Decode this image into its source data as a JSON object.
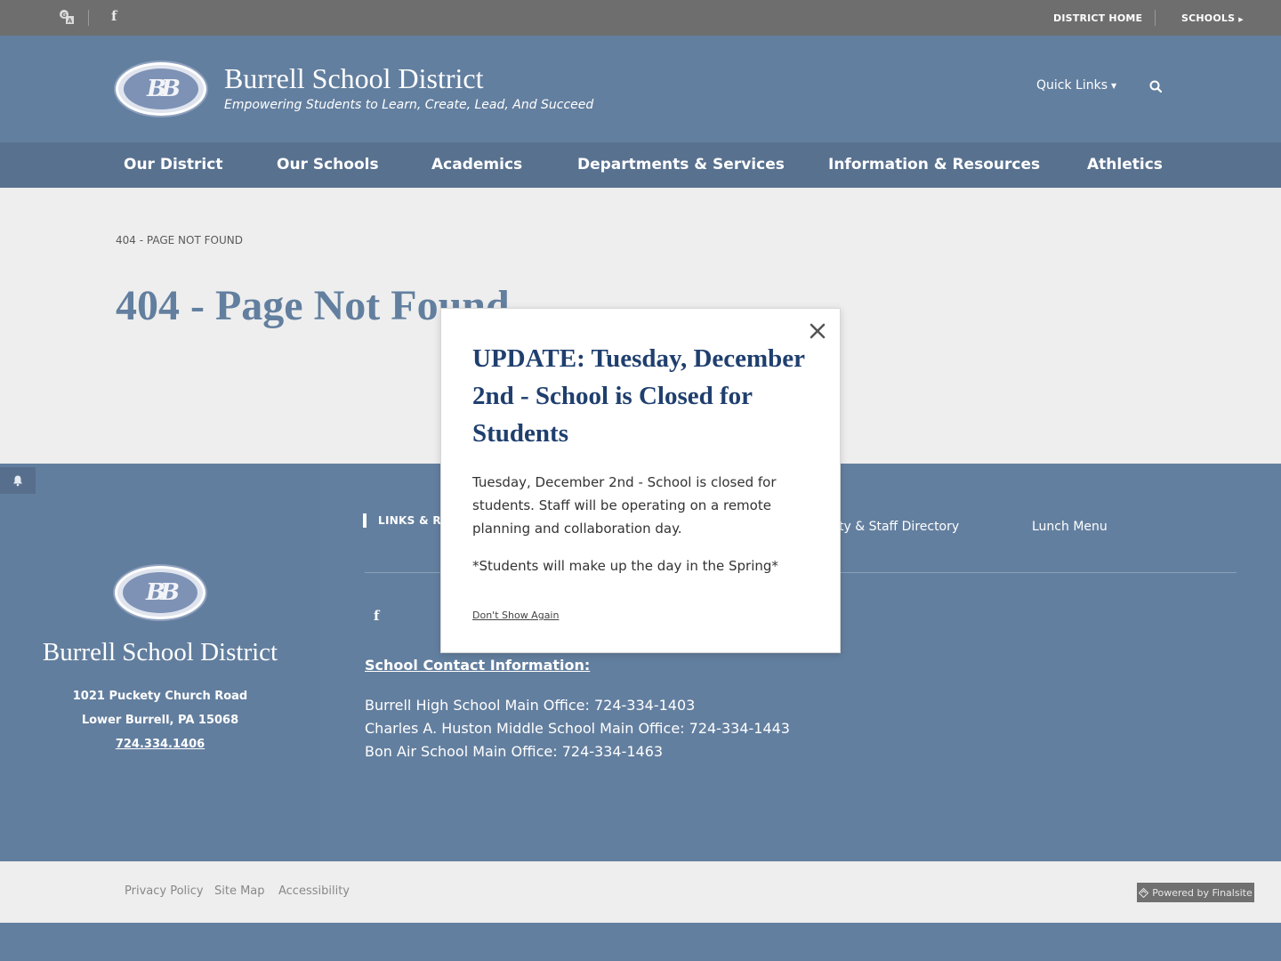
{
  "topbar": {
    "icons": [
      "translate-icon",
      "facebook-icon"
    ],
    "district_home": "DISTRICT HOME",
    "schools": "SCHOOLS"
  },
  "header": {
    "logo_letters": "BB",
    "title": "Burrell School District",
    "tagline": "Empowering Students to Learn, Create, Lead, And Succeed",
    "quick_links": "Quick Links"
  },
  "nav": {
    "items": [
      "Our District",
      "Our Schools",
      "Academics",
      "Departments & Services",
      "Information & Resources",
      "Athletics"
    ]
  },
  "content": {
    "breadcrumb": "404 - PAGE NOT FOUND",
    "title": "404 - Page Not Found"
  },
  "footer": {
    "title": "Burrell School District",
    "address_line1": "1021 Puckety Church Road",
    "address_line2": "Lower Burrell, PA  15068",
    "phone": "724.334.1406",
    "links_heading": "LINKS & RE",
    "links": [
      "ty & Staff Directory",
      "Lunch Menu"
    ],
    "contact_heading": "School Contact Information:",
    "contact_lines": [
      "Burrell High School Main Office:  724-334-1403",
      "Charles A. Huston Middle School Main Office:  724-334-1443",
      "Bon Air School Main Office:  724-334-1463"
    ]
  },
  "bottom": {
    "links": [
      "Privacy Policy",
      "Site Map",
      "Accessibility"
    ],
    "powered_by": "Powered by Finalsite"
  },
  "modal": {
    "title": "UPDATE: Tuesday, December 2nd - School is Closed for Students",
    "body": "Tuesday, December 2nd - School is closed for students.  Staff will be operating on a remote planning and collaboration day.",
    "note": "*Students will make up the day in the Spring*",
    "dont_show": "Don't Show Again"
  },
  "colors": {
    "header_blue": "#637f9f",
    "nav_blue": "#58718f",
    "modal_title": "#1f3f6e",
    "topbar_gray": "#6e6e6e"
  }
}
